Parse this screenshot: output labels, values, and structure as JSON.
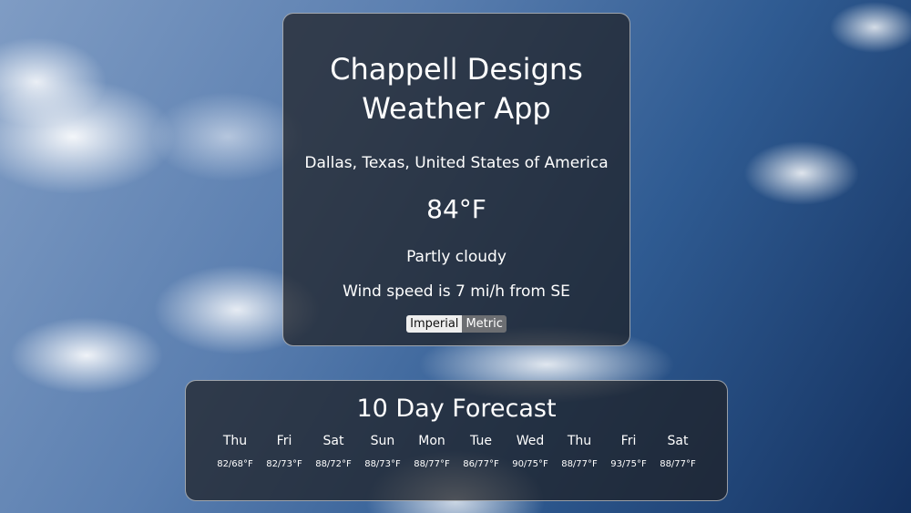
{
  "app": {
    "title_line1": "Chappell Designs",
    "title_line2": "Weather App"
  },
  "current": {
    "location": "Dallas, Texas, United States of America",
    "temperature": "84°F",
    "condition": "Partly cloudy",
    "wind": "Wind speed is 7 mi/h from SE"
  },
  "units": {
    "imperial_label": "Imperial",
    "metric_label": "Metric",
    "selected": "Imperial"
  },
  "forecast": {
    "title": "10 Day Forecast",
    "days": [
      {
        "day": "Thu",
        "temps": "82/68°F"
      },
      {
        "day": "Fri",
        "temps": "82/73°F"
      },
      {
        "day": "Sat",
        "temps": "88/72°F"
      },
      {
        "day": "Sun",
        "temps": "88/73°F"
      },
      {
        "day": "Mon",
        "temps": "88/77°F"
      },
      {
        "day": "Tue",
        "temps": "86/77°F"
      },
      {
        "day": "Wed",
        "temps": "90/75°F"
      },
      {
        "day": "Thu",
        "temps": "88/77°F"
      },
      {
        "day": "Fri",
        "temps": "93/75°F"
      },
      {
        "day": "Sat",
        "temps": "88/77°F"
      }
    ]
  }
}
